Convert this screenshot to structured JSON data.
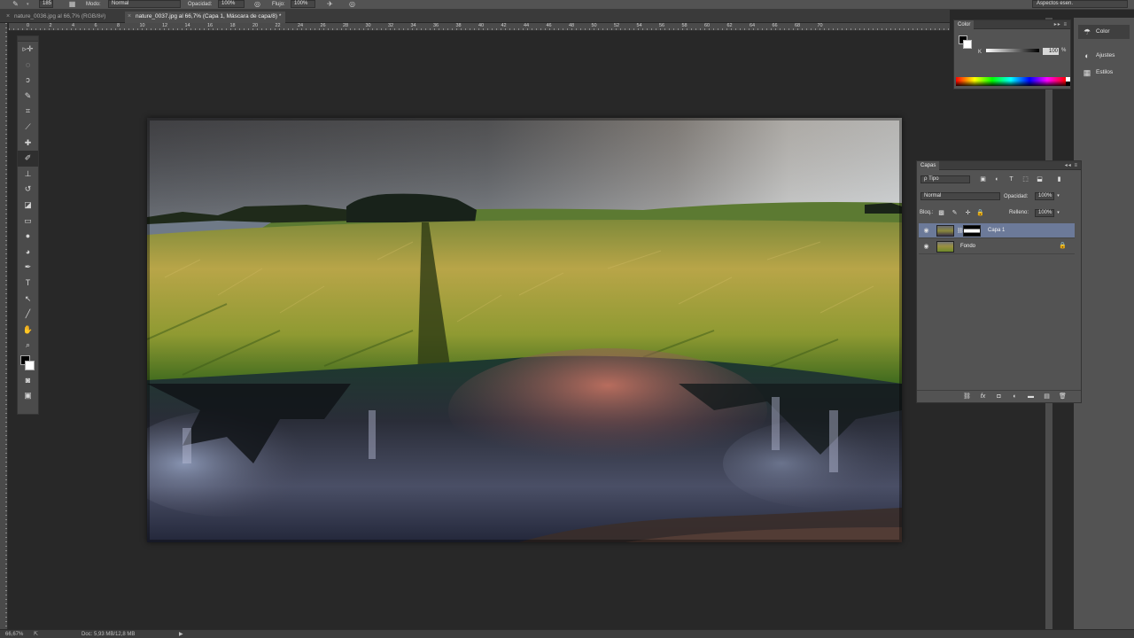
{
  "options_bar": {
    "brush_size": "185",
    "mode_label": "Modo:",
    "mode_value": "Normal",
    "opacity_label": "Opacidad:",
    "opacity_value": "100%",
    "flow_label": "Flujo:",
    "flow_value": "100%",
    "workspace": "Aspectos esen."
  },
  "tabs": [
    {
      "label": "nature_0036.jpg al 66,7% (RGB/8#)"
    },
    {
      "label": "nature_0037.jpg al 66,7% (Capa 1, Máscara de capa/8) *"
    }
  ],
  "ruler_h_ticks": [
    "0",
    "2",
    "4",
    "6",
    "8",
    "10",
    "12",
    "14",
    "16",
    "18",
    "20",
    "22",
    "24",
    "26",
    "28",
    "30",
    "32",
    "34",
    "36",
    "38",
    "40",
    "42",
    "44",
    "46",
    "48",
    "50",
    "52",
    "54",
    "56",
    "58",
    "60",
    "62",
    "64",
    "66",
    "68",
    "70"
  ],
  "tools": [
    {
      "name": "move-tool",
      "icon": "▹✛"
    },
    {
      "name": "marquee-tool",
      "icon": "◌"
    },
    {
      "name": "lasso-tool",
      "icon": "ↄ"
    },
    {
      "name": "quick-selection-tool",
      "icon": "✎"
    },
    {
      "name": "crop-tool",
      "icon": "⌗"
    },
    {
      "name": "eyedropper-tool",
      "icon": "⟋"
    },
    {
      "name": "healing-brush-tool",
      "icon": "✚"
    },
    {
      "name": "brush-tool",
      "icon": "✐"
    },
    {
      "name": "clone-stamp-tool",
      "icon": "⊥"
    },
    {
      "name": "history-brush-tool",
      "icon": "↺"
    },
    {
      "name": "eraser-tool",
      "icon": "◪"
    },
    {
      "name": "gradient-tool",
      "icon": "▭"
    },
    {
      "name": "blur-tool",
      "icon": "●"
    },
    {
      "name": "dodge-tool",
      "icon": "◕"
    },
    {
      "name": "pen-tool",
      "icon": "✒"
    },
    {
      "name": "type-tool",
      "icon": "T"
    },
    {
      "name": "path-selection-tool",
      "icon": "↖"
    },
    {
      "name": "line-tool",
      "icon": "╱"
    },
    {
      "name": "hand-tool",
      "icon": "✋"
    },
    {
      "name": "zoom-tool",
      "icon": "⌕"
    }
  ],
  "color_panel": {
    "tab": "Color",
    "channel": "K",
    "value": "100",
    "unit": "%",
    "controls": "▸▸ ≡"
  },
  "dock": [
    {
      "label": "Color",
      "icon": "☂"
    },
    {
      "label": "Ajustes",
      "icon": "◐"
    },
    {
      "label": "Estilos",
      "icon": "▦"
    }
  ],
  "layers_panel": {
    "tab": "Capas",
    "filter": "ρ Tipo",
    "blend_mode": "Normal",
    "opacity_label": "Opacidad:",
    "opacity_value": "100%",
    "lock_label": "Bloq.:",
    "fill_label": "Relleno:",
    "fill_value": "100%",
    "layers": [
      {
        "name": "Capa 1",
        "selected": true
      },
      {
        "name": "Fondo",
        "selected": false
      }
    ]
  },
  "status": {
    "zoom": "66,67%",
    "doc": "Doc: 5,93 MB/12,8 MB"
  },
  "colors": {
    "ui_panel": "#535353",
    "selected_layer": "#6c7a99",
    "background": "#282828"
  }
}
